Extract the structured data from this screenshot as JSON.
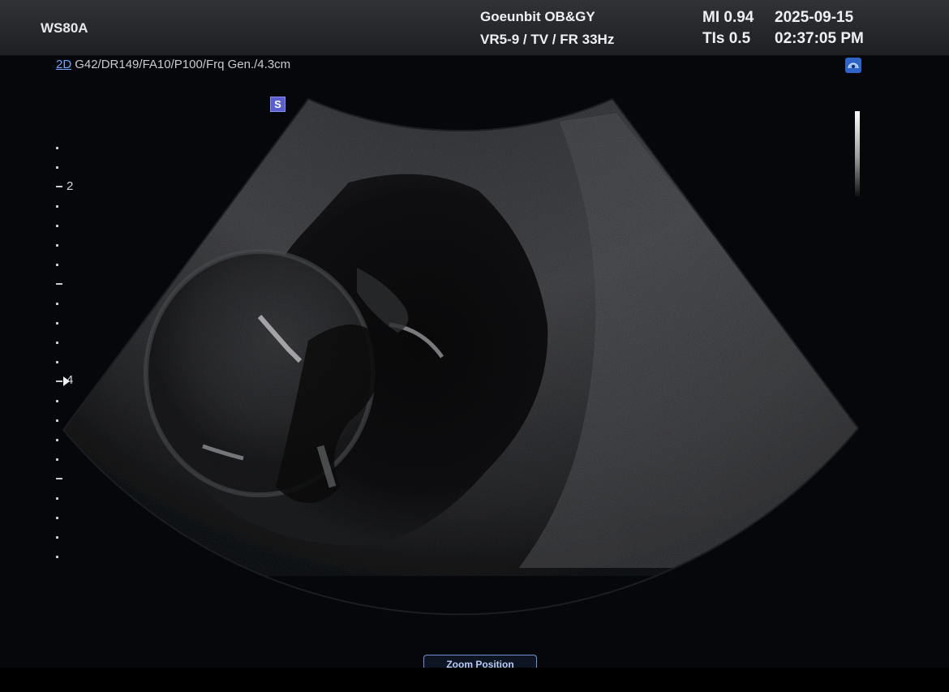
{
  "header": {
    "model": "WS80A",
    "hospital": "Goeunbit OB&GY",
    "probe_info": "VR5-9 / TV / FR 33Hz",
    "mi": "MI  0.94",
    "tis": "TIs 0.5",
    "date": "2025-09-15",
    "time": "02:37:05 PM"
  },
  "imaging": {
    "mode": "2D",
    "parameters": "G42/DR149/FA10/P100/Frq Gen./4.3cm",
    "orientation_badge": "S"
  },
  "depth_scale": {
    "labels": [
      "2",
      "4"
    ]
  },
  "controls": {
    "zoom_position_label": "Zoom Position"
  },
  "icons": {
    "probe_icon": "probe-icon",
    "grayscale_bar": "grayscale-bar-icon"
  },
  "colors": {
    "mode_accent": "#6ea6ff",
    "badge": "#5a5fd0",
    "probe_icon": "#2d64c8"
  }
}
